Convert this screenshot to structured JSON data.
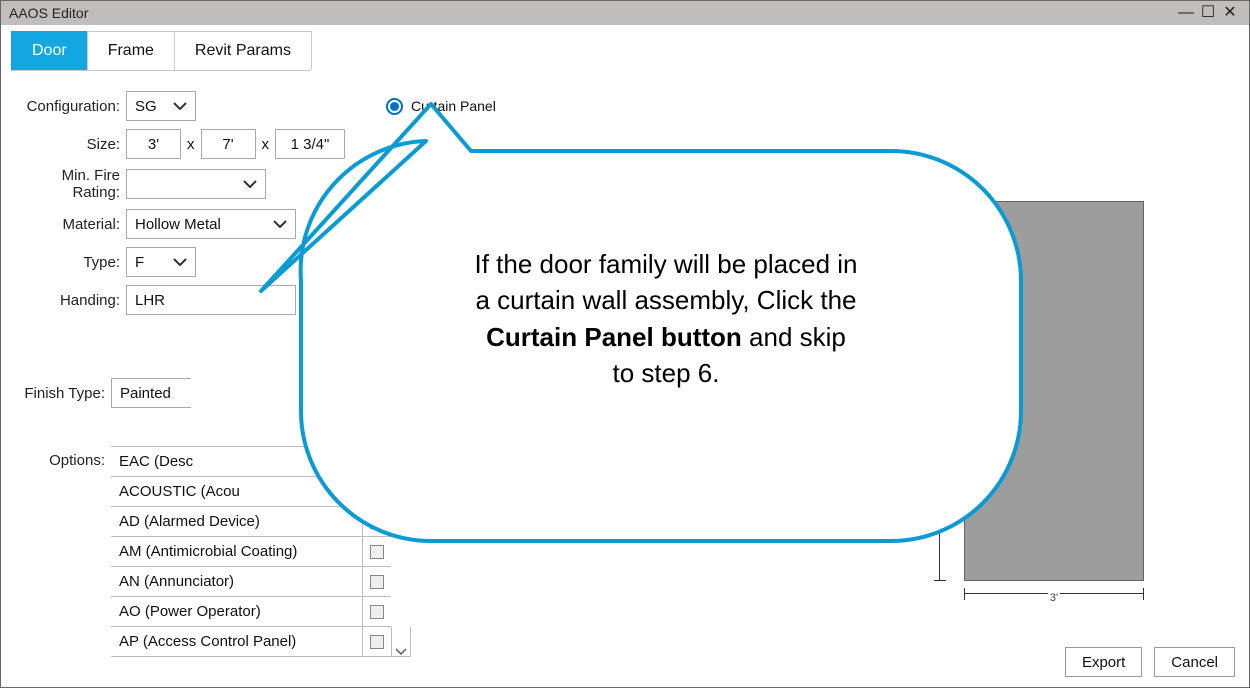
{
  "window": {
    "title": "AAOS Editor"
  },
  "tabs": {
    "door": "Door",
    "frame": "Frame",
    "revit": "Revit Params"
  },
  "form": {
    "configuration_label": "Configuration:",
    "configuration_value": "SG",
    "size_label": "Size:",
    "size_w": "3'",
    "size_h": "7'",
    "size_t": "1 3/4\"",
    "fire_label": "Min. Fire Rating:",
    "fire_value": "",
    "material_label": "Material:",
    "material_value": "Hollow Metal",
    "type_label": "Type:",
    "type_value": "F",
    "handing_label": "Handing:",
    "handing_value": "LHR",
    "finish_label": "Finish Type:",
    "finish_value": "Painted",
    "options_label": "Options:",
    "curtain_panel": "Curtain Panel"
  },
  "options": {
    "0": "EAC (Desc",
    "1": "ACOUSTIC (Acou",
    "2": "AD (Alarmed Device)",
    "3": "AM (Antimicrobial Coating)",
    "4": "AN (Annunciator)",
    "5": "AO (Power Operator)",
    "6": "AP (Access Control Panel)"
  },
  "preview": {
    "width_label": "3'"
  },
  "buttons": {
    "export": "Export",
    "cancel": "Cancel"
  },
  "callout": {
    "line1": "If the door family will be placed in",
    "line2": "a curtain wall assembly, Click the",
    "line3_bold": "Curtain Panel button",
    "line3_rest": " and skip",
    "line4": "to step 6."
  }
}
